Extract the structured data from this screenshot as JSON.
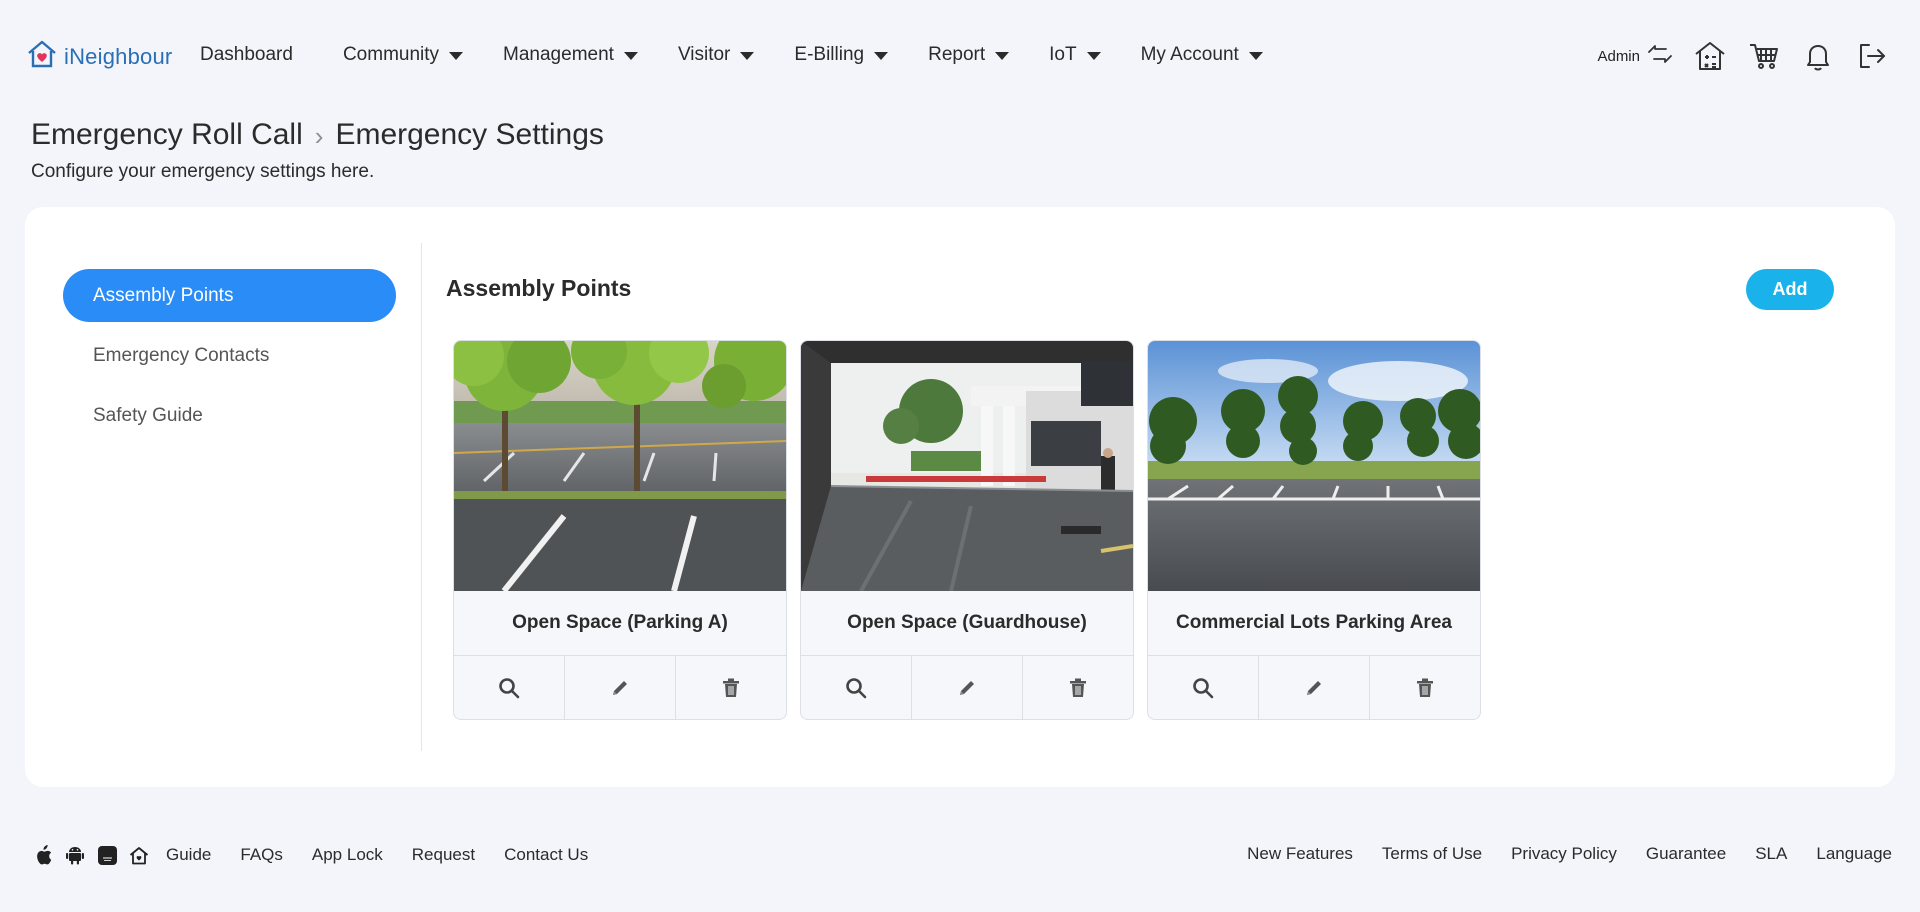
{
  "brand": {
    "name": "iNeighbour",
    "icon": "heart-house-icon",
    "color": "#2a6fb5"
  },
  "nav": {
    "items": [
      {
        "label": "Dashboard",
        "dropdown": false
      },
      {
        "label": "Community",
        "dropdown": true
      },
      {
        "label": "Management",
        "dropdown": true
      },
      {
        "label": "Visitor",
        "dropdown": true
      },
      {
        "label": "E-Billing",
        "dropdown": true
      },
      {
        "label": "Report",
        "dropdown": true
      },
      {
        "label": "IoT",
        "dropdown": true
      },
      {
        "label": "My Account",
        "dropdown": true
      }
    ]
  },
  "tools": {
    "admin_label": "Admin",
    "icons": [
      "switch-account-icon",
      "house-calculator-icon",
      "cart-icon",
      "bell-icon",
      "logout-icon"
    ]
  },
  "header": {
    "breadcrumb": [
      "Emergency Roll Call",
      "Emergency Settings"
    ],
    "subtitle": "Configure your emergency settings here."
  },
  "sidebar": {
    "items": [
      {
        "label": "Assembly Points",
        "active": true
      },
      {
        "label": "Emergency Contacts",
        "active": false
      },
      {
        "label": "Safety Guide",
        "active": false
      }
    ]
  },
  "main": {
    "title": "Assembly Points",
    "add_label": "Add",
    "points": [
      {
        "name": "Open Space (Parking A)",
        "photo": "parking-lot-trees-photo"
      },
      {
        "name": "Open Space (Guardhouse)",
        "photo": "guardhouse-entrance-photo"
      },
      {
        "name": "Commercial Lots Parking Area",
        "photo": "open-parking-area-photo"
      }
    ],
    "actions": [
      "view-icon",
      "edit-icon",
      "delete-icon"
    ]
  },
  "footer": {
    "app_icons": [
      "apple-icon",
      "android-icon",
      "huawei-icon",
      "home-icon"
    ],
    "left_links": [
      "Guide",
      "FAQs",
      "App Lock",
      "Request",
      "Contact Us"
    ],
    "right_links": [
      "New Features",
      "Terms of Use",
      "Privacy Policy",
      "Guarantee",
      "SLA",
      "Language"
    ]
  },
  "colors": {
    "primary": "#2a8cf7",
    "add_button": "#19b2ea",
    "background": "#f3f5fb"
  }
}
